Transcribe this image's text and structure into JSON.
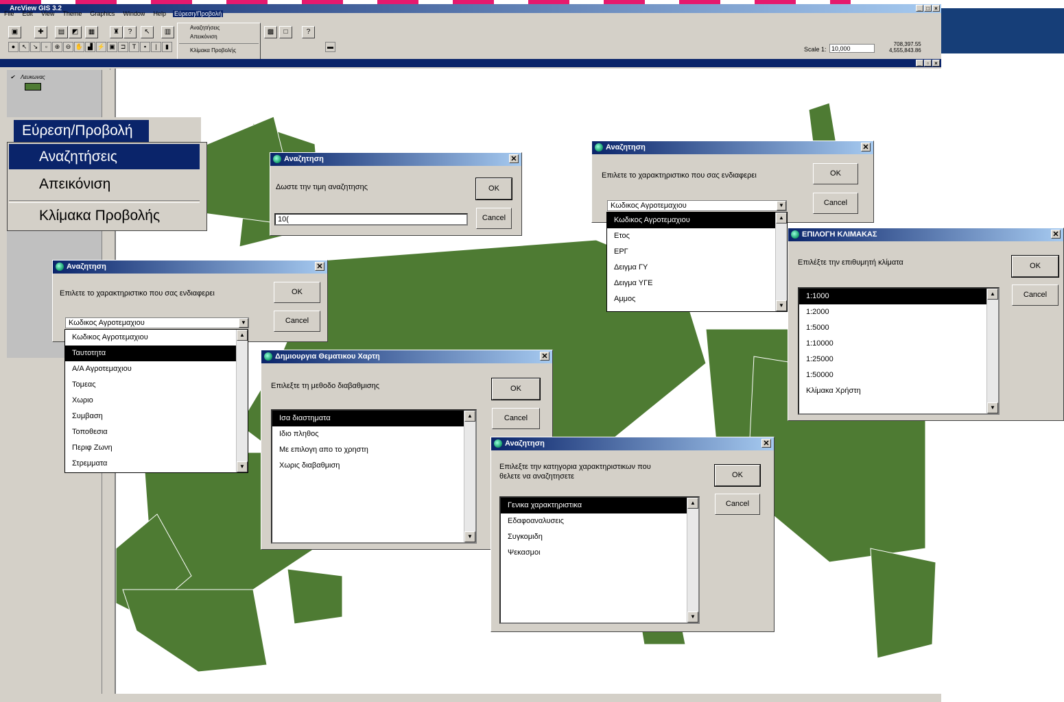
{
  "app": {
    "title": "ArcView GIS 3.2",
    "menu": [
      "File",
      "Edit",
      "View",
      "Theme",
      "Graphics",
      "Window",
      "Help",
      "Εύρεση/Προβολή"
    ],
    "scale_label": "Scale 1:",
    "scale_value": "10,000",
    "coords": [
      "708,397.55",
      "4,555,843.86"
    ]
  },
  "mini_menu": {
    "items": [
      "Αναζητήσεις",
      "Απεικόνιση",
      "Κλίμακα Προβολής"
    ]
  },
  "legend": {
    "theme_name": "Λευκωνας",
    "swatch_color": "#4e7b33"
  },
  "big_menu": {
    "title": "Εύρεση/Προβολή",
    "items": [
      "Αναζητήσεις",
      "Απεικόνιση",
      "Κλίμακα Προβολής"
    ]
  },
  "dialog_search_value": {
    "title": "Αναζητηση",
    "prompt": "Δωστε την τιμη αναζητησης",
    "input_value": "10(",
    "ok": "OK",
    "cancel": "Cancel"
  },
  "dialog_attr_right": {
    "title": "Αναζητηση",
    "prompt": "Επιλετε το χαρακτηριστικο που σας ενδιαφερει",
    "combo_value": "Κωδικος Αγροτεμαχιου",
    "options": [
      "Κωδικος Αγροτεμαχιου",
      "Ετος",
      "ΕΡΓ",
      "Δειγμα ΓΥ",
      "Δειγμα ΥΓΕ",
      "Αμμος"
    ],
    "ok": "OK",
    "cancel": "Cancel"
  },
  "dialog_scale": {
    "title": "ΕΠΙΛΟΓΗ ΚΛΙΜΑΚΑΣ",
    "prompt": "Επιλέξτε την επιθυμητή κλίματα",
    "options": [
      "1:1000",
      "1:2000",
      "1:5000",
      "1:10000",
      "1:25000",
      "1:50000",
      "Κλίμακα Χρήστη"
    ],
    "ok": "OK",
    "cancel": "Cancel"
  },
  "dialog_attr_left": {
    "title": "Αναζητηση",
    "prompt": "Επιλετε το χαρακτηριστικο που σας ενδιαφερει",
    "combo_value": "Κωδικος Αγροτεμαχιου",
    "options": [
      "Κωδικος Αγροτεμαχιου",
      "Ταυτοτητα",
      "Α/Α Αγροτεμαχιου",
      "Τομεας",
      "Χωριο",
      "Συμβαση",
      "Τοποθεσια",
      "Περιφ Ζωνη",
      "Στρεμματα"
    ],
    "ok": "OK",
    "cancel": "Cancel"
  },
  "dialog_thematic": {
    "title": "Δημιουργια Θεματικου Χαρτη",
    "prompt": "Επιλεξτε τη μεθοδο διαβαθμισης",
    "options": [
      "Ισα διαστηματα",
      "Ιδιο πληθος",
      "Με επιλογη απο το χρηστη",
      "Χωρις διαβαθμιση"
    ],
    "ok": "OK",
    "cancel": "Cancel"
  },
  "dialog_category": {
    "title": "Αναζητηση",
    "prompt_line1": "Επιλεξτε την κατηγορια χαρακτηριστικων που",
    "prompt_line2": "θελετε να αναζητησετε",
    "options": [
      "Γενικα χαρακτηριστικα",
      "Εδαφοαναλυσεις",
      "Συγκομιδη",
      "Ψεκασμοι"
    ],
    "ok": "OK",
    "cancel": "Cancel"
  }
}
